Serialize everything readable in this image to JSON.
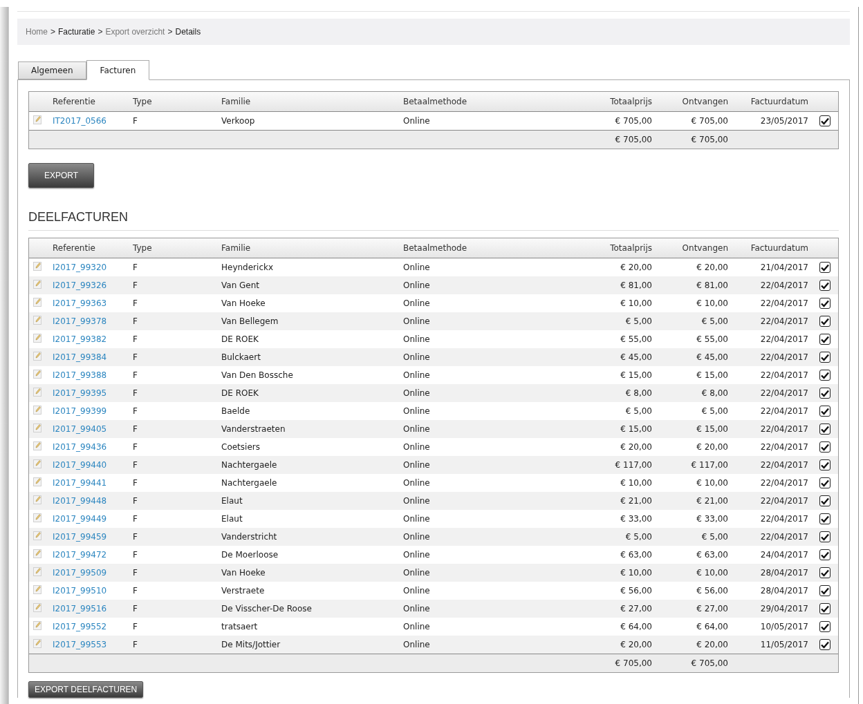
{
  "breadcrumb": [
    {
      "kind": "link",
      "text": "Home"
    },
    {
      "kind": "separator",
      "text": ">"
    },
    {
      "kind": "current",
      "text": "Facturatie"
    },
    {
      "kind": "separator",
      "text": ">"
    },
    {
      "kind": "link",
      "text": "Export overzicht"
    },
    {
      "kind": "separator",
      "text": ">"
    },
    {
      "kind": "current",
      "text": "Details"
    }
  ],
  "tabs": [
    {
      "label": "Algemeen",
      "selected": false
    },
    {
      "label": "Facturen",
      "selected": true
    }
  ],
  "facturen": {
    "columns": [
      "Referentie",
      "Type",
      "Familie",
      "Betaalmethode",
      "Totaalprijs",
      "Ontvangen",
      "Factuurdatum"
    ],
    "rows": [
      {
        "referentie": "IT2017_0566",
        "type": "F",
        "familie": "Verkoop",
        "betaalmethode": "Online",
        "totaalprijs": "€ 705,00",
        "ontvangen": "€ 705,00",
        "factuurdatum": "23/05/2017",
        "checked": true
      }
    ],
    "totals": {
      "totaalprijs": "€ 705,00",
      "ontvangen": "€ 705,00"
    }
  },
  "export_button": "EXPORT",
  "deelfacturen_heading": "DEELFACTUREN",
  "deelfacturen": {
    "columns": [
      "Referentie",
      "Type",
      "Familie",
      "Betaalmethode",
      "Totaalprijs",
      "Ontvangen",
      "Factuurdatum"
    ],
    "rows": [
      {
        "referentie": "I2017_99320",
        "type": "F",
        "familie": "Heynderickx",
        "betaalmethode": "Online",
        "totaalprijs": "€ 20,00",
        "ontvangen": "€ 20,00",
        "factuurdatum": "21/04/2017",
        "checked": true
      },
      {
        "referentie": "I2017_99326",
        "type": "F",
        "familie": "Van Gent",
        "betaalmethode": "Online",
        "totaalprijs": "€ 81,00",
        "ontvangen": "€ 81,00",
        "factuurdatum": "22/04/2017",
        "checked": true
      },
      {
        "referentie": "I2017_99363",
        "type": "F",
        "familie": "Van Hoeke",
        "betaalmethode": "Online",
        "totaalprijs": "€ 10,00",
        "ontvangen": "€ 10,00",
        "factuurdatum": "22/04/2017",
        "checked": true
      },
      {
        "referentie": "I2017_99378",
        "type": "F",
        "familie": "Van Bellegem",
        "betaalmethode": "Online",
        "totaalprijs": "€ 5,00",
        "ontvangen": "€ 5,00",
        "factuurdatum": "22/04/2017",
        "checked": true
      },
      {
        "referentie": "I2017_99382",
        "type": "F",
        "familie": "DE ROEK",
        "betaalmethode": "Online",
        "totaalprijs": "€ 55,00",
        "ontvangen": "€ 55,00",
        "factuurdatum": "22/04/2017",
        "checked": true
      },
      {
        "referentie": "I2017_99384",
        "type": "F",
        "familie": "Bulckaert",
        "betaalmethode": "Online",
        "totaalprijs": "€ 45,00",
        "ontvangen": "€ 45,00",
        "factuurdatum": "22/04/2017",
        "checked": true
      },
      {
        "referentie": "I2017_99388",
        "type": "F",
        "familie": "Van Den Bossche",
        "betaalmethode": "Online",
        "totaalprijs": "€ 15,00",
        "ontvangen": "€ 15,00",
        "factuurdatum": "22/04/2017",
        "checked": true
      },
      {
        "referentie": "I2017_99395",
        "type": "F",
        "familie": "DE ROEK",
        "betaalmethode": "Online",
        "totaalprijs": "€ 8,00",
        "ontvangen": "€ 8,00",
        "factuurdatum": "22/04/2017",
        "checked": true
      },
      {
        "referentie": "I2017_99399",
        "type": "F",
        "familie": "Baelde",
        "betaalmethode": "Online",
        "totaalprijs": "€ 5,00",
        "ontvangen": "€ 5,00",
        "factuurdatum": "22/04/2017",
        "checked": true
      },
      {
        "referentie": "I2017_99405",
        "type": "F",
        "familie": "Vanderstraeten",
        "betaalmethode": "Online",
        "totaalprijs": "€ 15,00",
        "ontvangen": "€ 15,00",
        "factuurdatum": "22/04/2017",
        "checked": true
      },
      {
        "referentie": "I2017_99436",
        "type": "F",
        "familie": "Coetsiers",
        "betaalmethode": "Online",
        "totaalprijs": "€ 20,00",
        "ontvangen": "€ 20,00",
        "factuurdatum": "22/04/2017",
        "checked": true
      },
      {
        "referentie": "I2017_99440",
        "type": "F",
        "familie": "Nachtergaele",
        "betaalmethode": "Online",
        "totaalprijs": "€ 117,00",
        "ontvangen": "€ 117,00",
        "factuurdatum": "22/04/2017",
        "checked": true
      },
      {
        "referentie": "I2017_99441",
        "type": "F",
        "familie": "Nachtergaele",
        "betaalmethode": "Online",
        "totaalprijs": "€ 10,00",
        "ontvangen": "€ 10,00",
        "factuurdatum": "22/04/2017",
        "checked": true
      },
      {
        "referentie": "I2017_99448",
        "type": "F",
        "familie": "Elaut",
        "betaalmethode": "Online",
        "totaalprijs": "€ 21,00",
        "ontvangen": "€ 21,00",
        "factuurdatum": "22/04/2017",
        "checked": true
      },
      {
        "referentie": "I2017_99449",
        "type": "F",
        "familie": "Elaut",
        "betaalmethode": "Online",
        "totaalprijs": "€ 33,00",
        "ontvangen": "€ 33,00",
        "factuurdatum": "22/04/2017",
        "checked": true
      },
      {
        "referentie": "I2017_99459",
        "type": "F",
        "familie": "Vanderstricht",
        "betaalmethode": "Online",
        "totaalprijs": "€ 5,00",
        "ontvangen": "€ 5,00",
        "factuurdatum": "22/04/2017",
        "checked": true
      },
      {
        "referentie": "I2017_99472",
        "type": "F",
        "familie": "De Moerloose",
        "betaalmethode": "Online",
        "totaalprijs": "€ 63,00",
        "ontvangen": "€ 63,00",
        "factuurdatum": "24/04/2017",
        "checked": true
      },
      {
        "referentie": "I2017_99509",
        "type": "F",
        "familie": "Van Hoeke",
        "betaalmethode": "Online",
        "totaalprijs": "€ 10,00",
        "ontvangen": "€ 10,00",
        "factuurdatum": "28/04/2017",
        "checked": true
      },
      {
        "referentie": "I2017_99510",
        "type": "F",
        "familie": "Verstraete",
        "betaalmethode": "Online",
        "totaalprijs": "€ 56,00",
        "ontvangen": "€ 56,00",
        "factuurdatum": "28/04/2017",
        "checked": true
      },
      {
        "referentie": "I2017_99516",
        "type": "F",
        "familie": "De Visscher-De Roose",
        "betaalmethode": "Online",
        "totaalprijs": "€ 27,00",
        "ontvangen": "€ 27,00",
        "factuurdatum": "29/04/2017",
        "checked": true
      },
      {
        "referentie": "I2017_99552",
        "type": "F",
        "familie": "tratsaert",
        "betaalmethode": "Online",
        "totaalprijs": "€ 64,00",
        "ontvangen": "€ 64,00",
        "factuurdatum": "10/05/2017",
        "checked": true
      },
      {
        "referentie": "I2017_99553",
        "type": "F",
        "familie": "De Mits/Jottier",
        "betaalmethode": "Online",
        "totaalprijs": "€ 20,00",
        "ontvangen": "€ 20,00",
        "factuurdatum": "11/05/2017",
        "checked": true
      }
    ],
    "totals": {
      "totaalprijs": "€ 705,00",
      "ontvangen": "€ 705,00"
    }
  },
  "export_deelfacturen_button": "EXPORT DEELFACTUREN"
}
